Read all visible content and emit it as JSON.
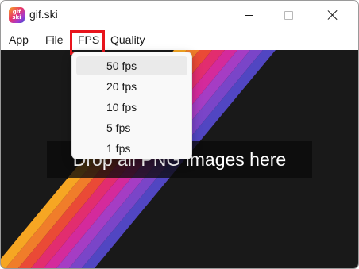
{
  "window": {
    "title": "gif.ski",
    "icon_text": "gif\nski"
  },
  "menubar": {
    "items": [
      "App",
      "File",
      "FPS",
      "Quality"
    ]
  },
  "fps_menu": {
    "options": [
      "50 fps",
      "20 fps",
      "10 fps",
      "5 fps",
      "1 fps"
    ],
    "hovered": "50 fps"
  },
  "content": {
    "drop_prompt": "Drop all PNG images here"
  },
  "colors": {
    "content_bg": "#191919",
    "stripes": [
      "#f6a623",
      "#f07d2a",
      "#ea4a36",
      "#e22d6f",
      "#d42a9c",
      "#a53dc4",
      "#7a45c8",
      "#5146c2"
    ],
    "highlight_box": "#e8141c"
  }
}
